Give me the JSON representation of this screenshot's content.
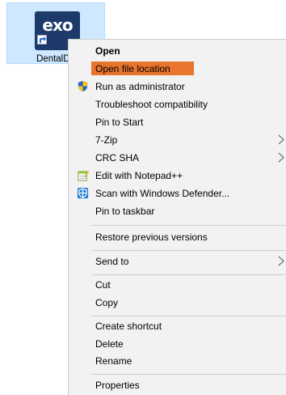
{
  "desktop_icon": {
    "logo_text": "exo",
    "label": "DentalD"
  },
  "menu": {
    "highlight_color": "#e8742d",
    "items": [
      {
        "label": "Open",
        "bold": true
      },
      {
        "label": "Open file location",
        "highlight": true
      },
      {
        "label": "Run as administrator",
        "icon": "shield-icon"
      },
      {
        "label": "Troubleshoot compatibility"
      },
      {
        "label": "Pin to Start"
      },
      {
        "label": "7-Zip",
        "submenu": true
      },
      {
        "label": "CRC SHA",
        "submenu": true
      },
      {
        "label": "Edit with Notepad++",
        "icon": "notepad-icon"
      },
      {
        "label": "Scan with Windows Defender...",
        "icon": "defender-icon"
      },
      {
        "label": "Pin to taskbar"
      },
      {
        "label": "Restore previous versions"
      },
      {
        "label": "Send to",
        "submenu": true
      },
      {
        "label": "Cut"
      },
      {
        "label": "Copy"
      },
      {
        "label": "Create shortcut"
      },
      {
        "label": "Delete"
      },
      {
        "label": "Rename"
      },
      {
        "label": "Properties"
      }
    ]
  }
}
